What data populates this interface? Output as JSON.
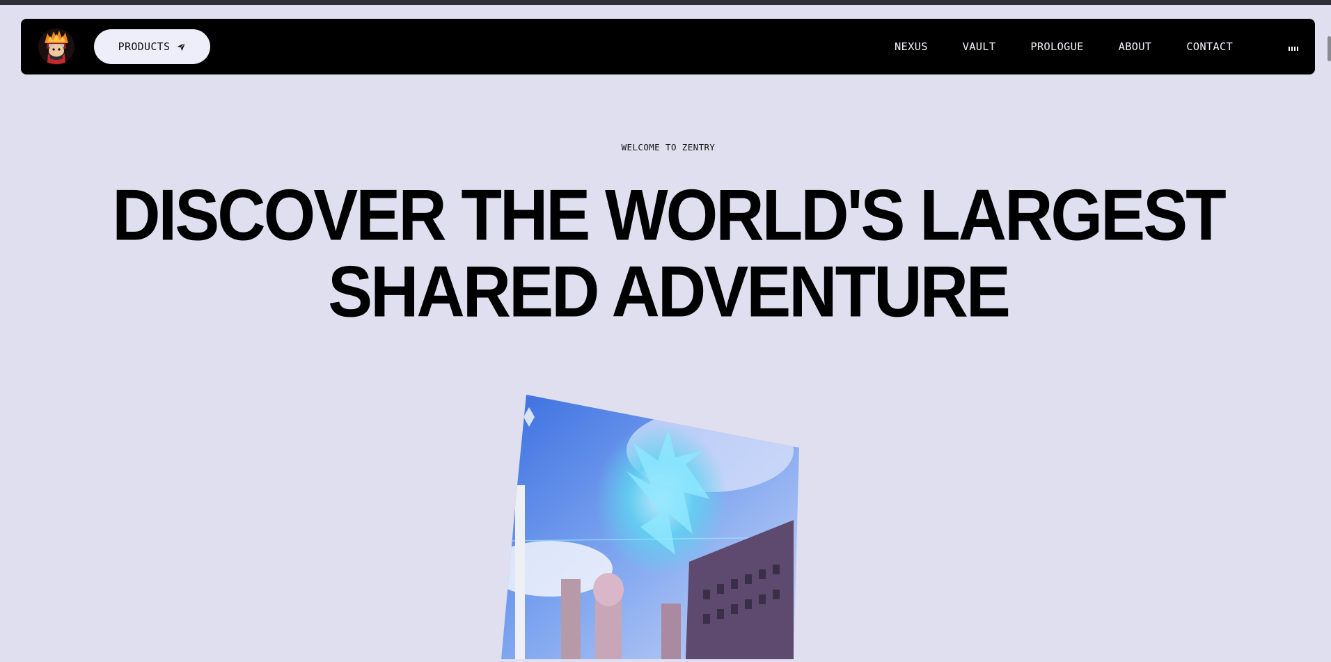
{
  "nav": {
    "products_label": "PRODUCTS",
    "links": [
      "NEXUS",
      "VAULT",
      "PROLOGUE",
      "ABOUT",
      "CONTACT"
    ]
  },
  "hero": {
    "eyebrow": "WELCOME TO ZENTRY",
    "headline_line1": "DISCOVER THE WORLD'S LARGEST",
    "headline_line2": "SHARED ADVENTURE"
  },
  "icons": {
    "logo": "ninja-avatar-logo",
    "products": "paper-plane-icon",
    "audio": "audio-bars-icon"
  },
  "colors": {
    "background": "#dfdff0",
    "navbar": "#000000",
    "button": "#eeeefa",
    "text": "#000000"
  }
}
